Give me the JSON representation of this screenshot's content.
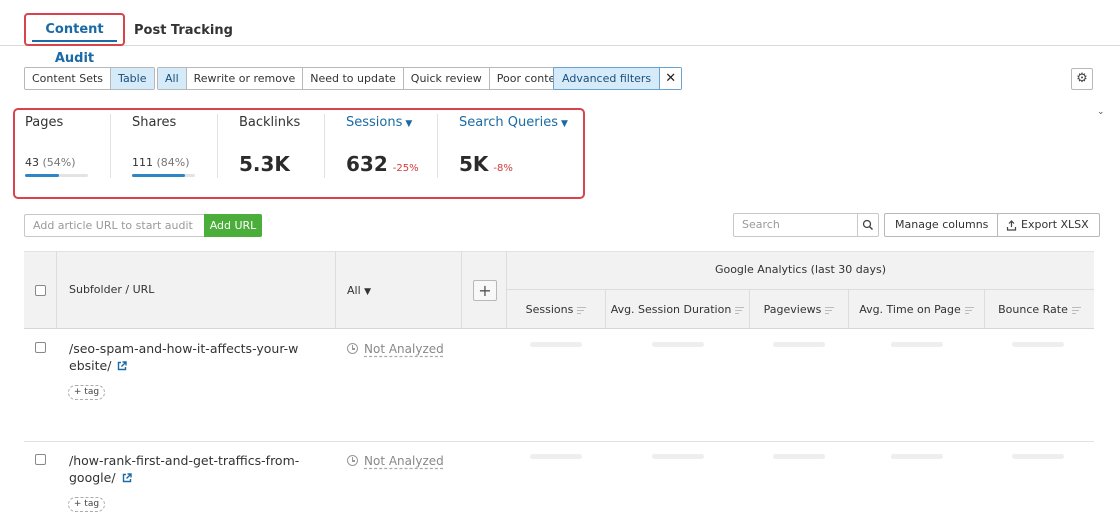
{
  "tabs": {
    "active": "Content Audit",
    "other": "Post Tracking"
  },
  "toolbar": {
    "view_toggle": [
      "Content Sets",
      "Table"
    ],
    "view_selected": "Table",
    "filters": [
      "All",
      "Rewrite or remove",
      "Need to update",
      "Quick review",
      "Poor content"
    ],
    "filter_selected": "All",
    "advanced_filters": "Advanced filters"
  },
  "metrics": {
    "pages": {
      "label": "Pages",
      "value": "43",
      "pct": "(54%)",
      "fill": 0.54
    },
    "shares": {
      "label": "Shares",
      "value": "111",
      "pct": "(84%)",
      "fill": 0.84
    },
    "backlinks": {
      "label": "Backlinks",
      "value": "5.3K"
    },
    "sessions": {
      "label": "Sessions",
      "value": "632",
      "delta": "-25%"
    },
    "search_queries": {
      "label": "Search Queries",
      "value": "5K",
      "delta": "-8%"
    }
  },
  "add_url": {
    "placeholder": "Add article URL to start audit",
    "button": "Add URL"
  },
  "search": {
    "placeholder": "Search"
  },
  "buttons": {
    "manage_columns": "Manage columns",
    "export": "Export XLSX"
  },
  "table": {
    "col_url": "Subfolder / URL",
    "col_status": "All",
    "ga_group": "Google Analytics (last 30 days)",
    "ga_columns": [
      "Sessions",
      "Avg. Session Duration",
      "Pageviews",
      "Avg. Time on Page",
      "Bounce Rate"
    ],
    "rows": [
      {
        "url_line1": "/seo-spam-and-how-it-affects-your-w",
        "url_line2": "ebsite/",
        "tag": "+ tag",
        "status": "Not Analyzed"
      },
      {
        "url_line1": "/how-rank-first-and-get-traffics-from-",
        "url_line2": "google/",
        "tag": "+ tag",
        "status": "Not Analyzed"
      }
    ]
  }
}
